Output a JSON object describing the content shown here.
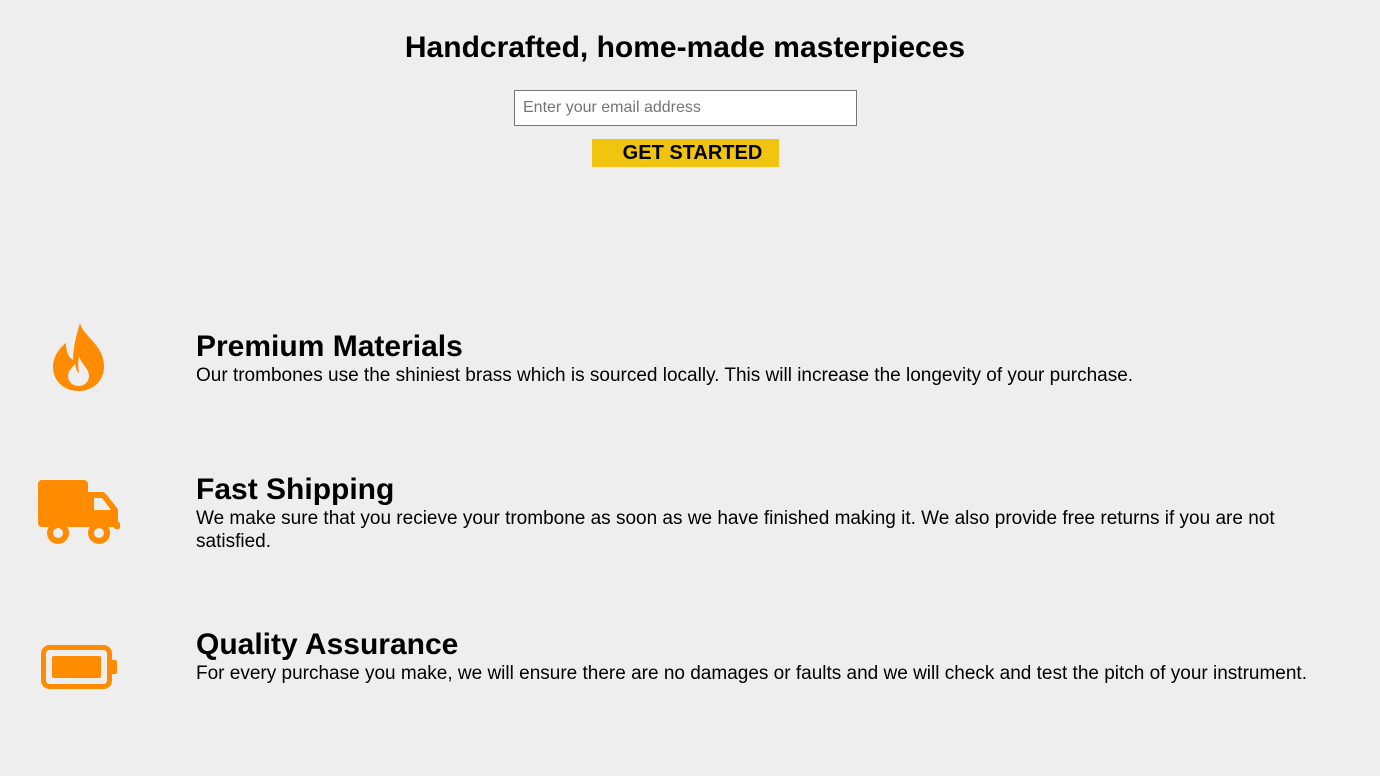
{
  "hero": {
    "title": "Handcrafted, home-made masterpieces",
    "email_placeholder": "Enter your email address",
    "cta_label": "GET STARTED"
  },
  "features": [
    {
      "icon": "fire-icon",
      "title": "Premium Materials",
      "description": "Our trombones use the shiniest brass which is sourced locally. This will increase the longevity of your purchase."
    },
    {
      "icon": "truck-icon",
      "title": "Fast Shipping",
      "description": "We make sure that you recieve your trombone as soon as we have finished making it. We also provide free returns if you are not satisfied."
    },
    {
      "icon": "battery-icon",
      "title": "Quality Assurance",
      "description": "For every purchase you make, we will ensure there are no damages or faults and we will check and test the pitch of your instrument."
    }
  ],
  "colors": {
    "background": "#eeeeee",
    "accent_button": "#f1c40f",
    "icon_orange": "#ff8c00"
  }
}
